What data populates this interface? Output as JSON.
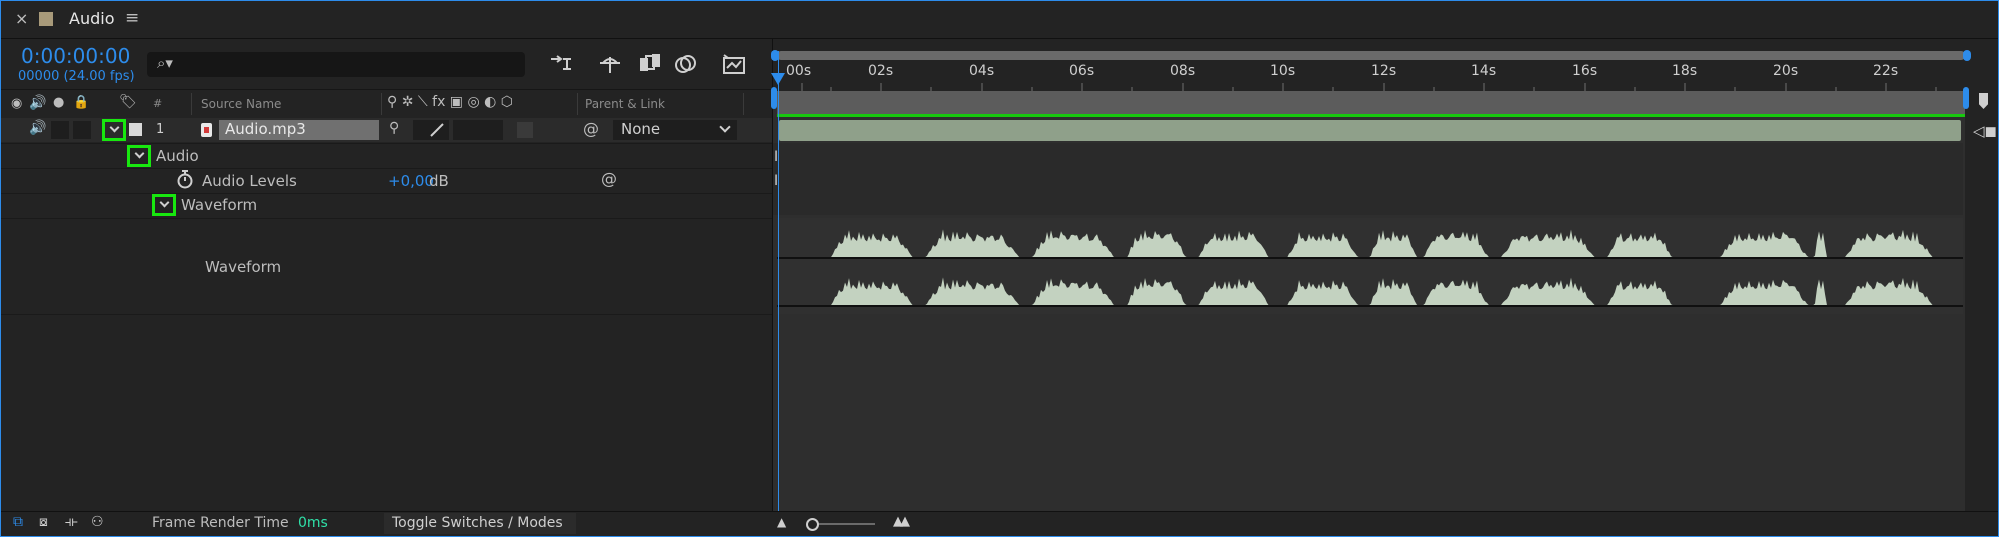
{
  "tab": {
    "title": "Audio",
    "close": "×",
    "menu": "≡"
  },
  "time": {
    "timecode": "0:00:00:00",
    "frames": "00000 (24.00 fps)"
  },
  "search": {
    "placeholder": "ρ▾"
  },
  "columns": {
    "num": "#",
    "source_name": "Source Name",
    "parent_link": "Parent & Link"
  },
  "layer": {
    "index": "1",
    "name": "Audio.mp3",
    "parent": "None"
  },
  "tree": {
    "audio_group": "Audio",
    "audio_levels": "Audio Levels",
    "audio_levels_value": "+0,00",
    "audio_levels_unit": "dB",
    "waveform_group": "Waveform",
    "waveform_label": "Waveform"
  },
  "ruler": {
    "labels": [
      "00s",
      "02s",
      "04s",
      "06s",
      "08s",
      "10s",
      "12s",
      "14s",
      "16s",
      "18s",
      "20s",
      "22s"
    ]
  },
  "footer": {
    "frame_render_label": "Frame Render Time",
    "frame_render_value": "0ms",
    "toggle_label": "Toggle Switches / Modes"
  },
  "colors": {
    "accent": "#2d8ceb",
    "highlight": "#18e80f",
    "layer_bar": "#8fa08a",
    "waveform": "#c3d2c0"
  }
}
